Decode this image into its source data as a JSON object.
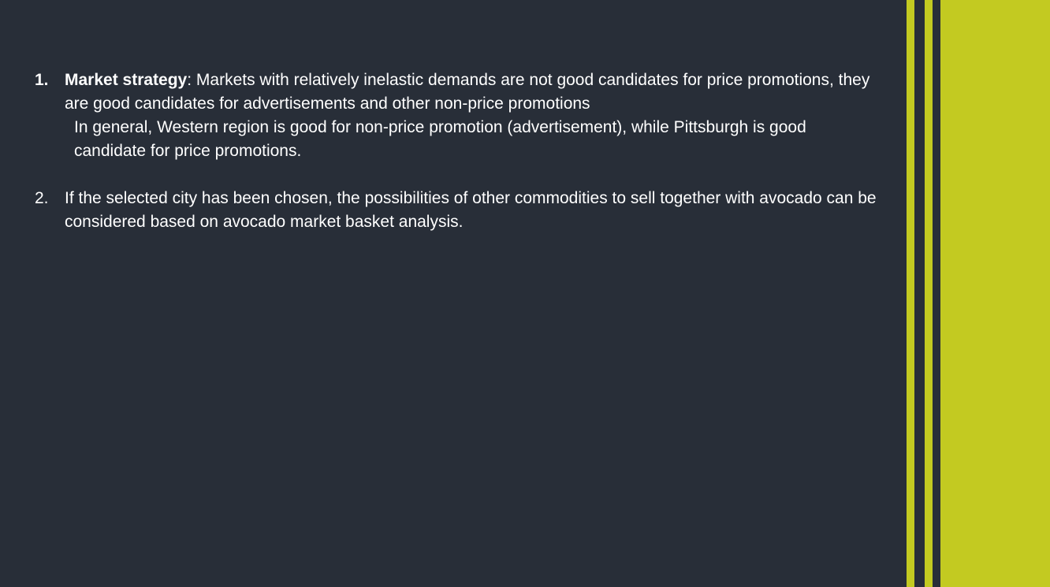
{
  "colors": {
    "background": "#282e38",
    "accent": "#c3ca21",
    "text": "#ffffff"
  },
  "items": [
    {
      "number": "1.",
      "term": "Market strategy",
      "separator": ":",
      "text": " Markets with relatively inelastic demands are not good candidates for price promotions, they are good candidates for advertisements and other non-price promotions",
      "note": "In general, Western region is good for non-price promotion (advertisement), while Pittsburgh is good candidate for price promotions."
    },
    {
      "number": "2.",
      "text": "If the selected city has been chosen, the possibilities of other commodities to sell together with avocado can be considered based on avocado market basket analysis."
    }
  ]
}
